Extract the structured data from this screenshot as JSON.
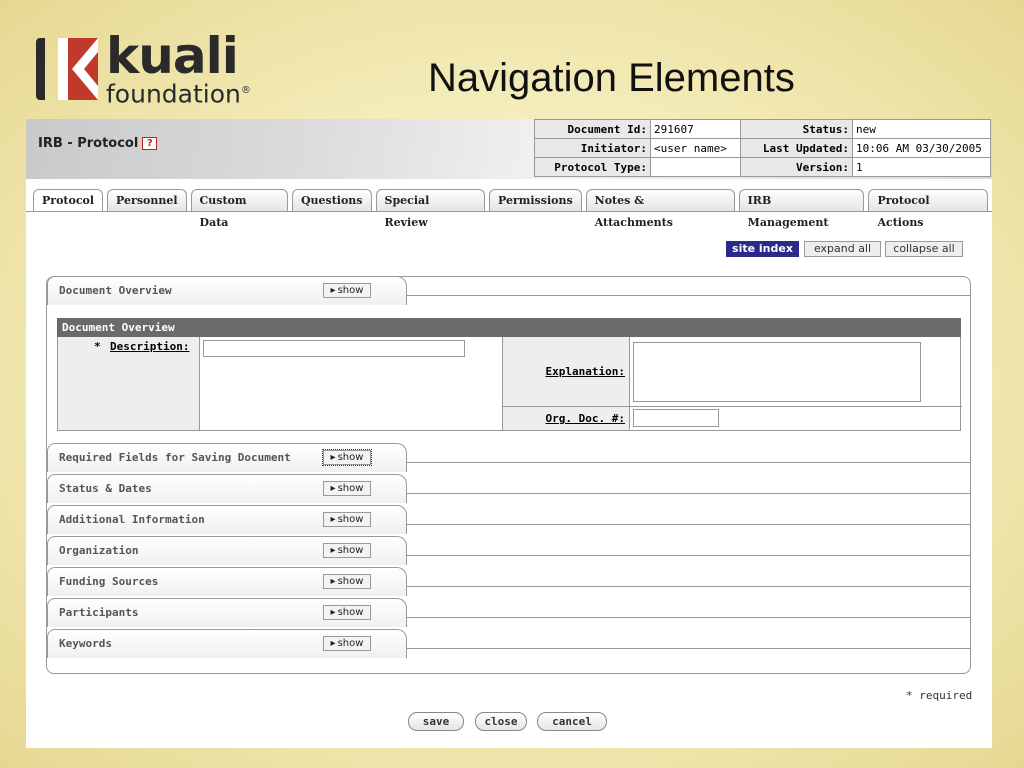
{
  "slide": {
    "title": "Navigation Elements",
    "logo": {
      "word": "kuali",
      "sub": "foundation",
      "reg": "®"
    }
  },
  "header": {
    "title": "IRB - Protocol",
    "help": "?",
    "doc": {
      "doc_id_label": "Document Id:",
      "doc_id": "291607",
      "status_label": "Status:",
      "status": "new",
      "initiator_label": "Initiator:",
      "initiator": "<user name>",
      "last_updated_label": "Last Updated:",
      "last_updated": "10:06 AM 03/30/2005",
      "protocol_type_label": "Protocol Type:",
      "protocol_type": "",
      "version_label": "Version:",
      "version": "1"
    }
  },
  "tabs": [
    "Protocol",
    "Personnel",
    "Custom Data",
    "Questions",
    "Special Review",
    "Permissions",
    "Notes & Attachments",
    "IRB Management",
    "Protocol Actions"
  ],
  "actions": {
    "site_index": "site index",
    "expand_all": "expand all",
    "collapse_all": "collapse all"
  },
  "sections": [
    {
      "label": "Document Overview",
      "button": "show"
    },
    {
      "label": "Required Fields for Saving Document",
      "button": "show"
    },
    {
      "label": "Status & Dates",
      "button": "show"
    },
    {
      "label": "Additional Information",
      "button": "show"
    },
    {
      "label": "Organization",
      "button": "show"
    },
    {
      "label": "Funding Sources",
      "button": "show"
    },
    {
      "label": "Participants",
      "button": "show"
    },
    {
      "label": "Keywords",
      "button": "show"
    }
  ],
  "overview": {
    "header": "Document Overview",
    "description_label": "Description:",
    "required_mark": "*",
    "explanation_label": "Explanation:",
    "org_doc_label": "Org. Doc. #:",
    "description_value": "",
    "explanation_value": "",
    "org_doc_value": ""
  },
  "footer": {
    "required_note": "* required",
    "save": "save",
    "close": "close",
    "cancel": "cancel"
  },
  "colors": {
    "site_index_bg": "#2a2a8a",
    "logo_red": "#c0392b",
    "overview_header": "#6a6a6a"
  }
}
